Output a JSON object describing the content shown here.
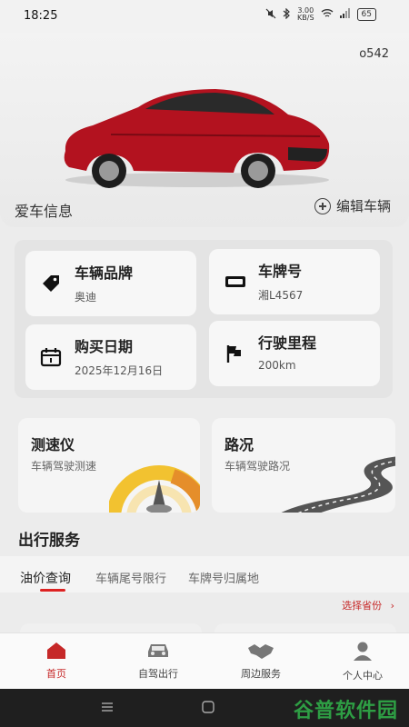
{
  "status_bar": {
    "time": "18:25",
    "net_speed_top": "3.00",
    "net_speed_unit": "KB/S",
    "battery": "65"
  },
  "hero": {
    "car_id": "o542",
    "title": "爱车信息",
    "edit_label": "编辑车辆"
  },
  "info_cards": [
    {
      "label": "车辆品牌",
      "value": "奥迪",
      "icon": "tag-icon"
    },
    {
      "label": "车牌号",
      "value": "湘L4567",
      "icon": "license-plate-icon"
    },
    {
      "label": "购买日期",
      "value": "2025年12月16日",
      "icon": "calendar-icon"
    },
    {
      "label": "行驶里程",
      "value": "200km",
      "icon": "flag-icon"
    }
  ],
  "features": [
    {
      "title": "测速仪",
      "subtitle": "车辆驾驶测速",
      "icon": "speedometer-icon"
    },
    {
      "title": "路况",
      "subtitle": "车辆驾驶路况",
      "icon": "road-icon"
    }
  ],
  "travel": {
    "section_title": "出行服务",
    "tabs": [
      "油价查询",
      "车辆尾号限行",
      "车牌号归属地"
    ],
    "active_tab": 0,
    "select_province": "选择省份"
  },
  "bottom_nav": [
    {
      "label": "首页",
      "icon": "home-icon",
      "active": true
    },
    {
      "label": "自驾出行",
      "icon": "car-icon",
      "active": false
    },
    {
      "label": "周边服务",
      "icon": "handshake-icon",
      "active": false
    },
    {
      "label": "个人中心",
      "icon": "person-icon",
      "active": false
    }
  ],
  "watermark": "谷普软件园",
  "colors": {
    "accent": "#c62828",
    "car_red": "#b3121f",
    "watermark_green": "#2e9e44"
  }
}
